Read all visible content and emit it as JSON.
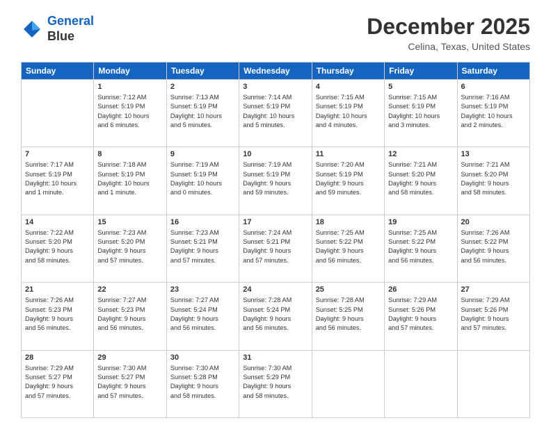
{
  "header": {
    "logo_line1": "General",
    "logo_line2": "Blue",
    "month": "December 2025",
    "location": "Celina, Texas, United States"
  },
  "days_of_week": [
    "Sunday",
    "Monday",
    "Tuesday",
    "Wednesday",
    "Thursday",
    "Friday",
    "Saturday"
  ],
  "weeks": [
    [
      {
        "day": "",
        "info": ""
      },
      {
        "day": "1",
        "info": "Sunrise: 7:12 AM\nSunset: 5:19 PM\nDaylight: 10 hours\nand 6 minutes."
      },
      {
        "day": "2",
        "info": "Sunrise: 7:13 AM\nSunset: 5:19 PM\nDaylight: 10 hours\nand 5 minutes."
      },
      {
        "day": "3",
        "info": "Sunrise: 7:14 AM\nSunset: 5:19 PM\nDaylight: 10 hours\nand 5 minutes."
      },
      {
        "day": "4",
        "info": "Sunrise: 7:15 AM\nSunset: 5:19 PM\nDaylight: 10 hours\nand 4 minutes."
      },
      {
        "day": "5",
        "info": "Sunrise: 7:15 AM\nSunset: 5:19 PM\nDaylight: 10 hours\nand 3 minutes."
      },
      {
        "day": "6",
        "info": "Sunrise: 7:16 AM\nSunset: 5:19 PM\nDaylight: 10 hours\nand 2 minutes."
      }
    ],
    [
      {
        "day": "7",
        "info": "Sunrise: 7:17 AM\nSunset: 5:19 PM\nDaylight: 10 hours\nand 1 minute."
      },
      {
        "day": "8",
        "info": "Sunrise: 7:18 AM\nSunset: 5:19 PM\nDaylight: 10 hours\nand 1 minute."
      },
      {
        "day": "9",
        "info": "Sunrise: 7:19 AM\nSunset: 5:19 PM\nDaylight: 10 hours\nand 0 minutes."
      },
      {
        "day": "10",
        "info": "Sunrise: 7:19 AM\nSunset: 5:19 PM\nDaylight: 9 hours\nand 59 minutes."
      },
      {
        "day": "11",
        "info": "Sunrise: 7:20 AM\nSunset: 5:19 PM\nDaylight: 9 hours\nand 59 minutes."
      },
      {
        "day": "12",
        "info": "Sunrise: 7:21 AM\nSunset: 5:20 PM\nDaylight: 9 hours\nand 58 minutes."
      },
      {
        "day": "13",
        "info": "Sunrise: 7:21 AM\nSunset: 5:20 PM\nDaylight: 9 hours\nand 58 minutes."
      }
    ],
    [
      {
        "day": "14",
        "info": "Sunrise: 7:22 AM\nSunset: 5:20 PM\nDaylight: 9 hours\nand 58 minutes."
      },
      {
        "day": "15",
        "info": "Sunrise: 7:23 AM\nSunset: 5:20 PM\nDaylight: 9 hours\nand 57 minutes."
      },
      {
        "day": "16",
        "info": "Sunrise: 7:23 AM\nSunset: 5:21 PM\nDaylight: 9 hours\nand 57 minutes."
      },
      {
        "day": "17",
        "info": "Sunrise: 7:24 AM\nSunset: 5:21 PM\nDaylight: 9 hours\nand 57 minutes."
      },
      {
        "day": "18",
        "info": "Sunrise: 7:25 AM\nSunset: 5:22 PM\nDaylight: 9 hours\nand 56 minutes."
      },
      {
        "day": "19",
        "info": "Sunrise: 7:25 AM\nSunset: 5:22 PM\nDaylight: 9 hours\nand 56 minutes."
      },
      {
        "day": "20",
        "info": "Sunrise: 7:26 AM\nSunset: 5:22 PM\nDaylight: 9 hours\nand 56 minutes."
      }
    ],
    [
      {
        "day": "21",
        "info": "Sunrise: 7:26 AM\nSunset: 5:23 PM\nDaylight: 9 hours\nand 56 minutes."
      },
      {
        "day": "22",
        "info": "Sunrise: 7:27 AM\nSunset: 5:23 PM\nDaylight: 9 hours\nand 56 minutes."
      },
      {
        "day": "23",
        "info": "Sunrise: 7:27 AM\nSunset: 5:24 PM\nDaylight: 9 hours\nand 56 minutes."
      },
      {
        "day": "24",
        "info": "Sunrise: 7:28 AM\nSunset: 5:24 PM\nDaylight: 9 hours\nand 56 minutes."
      },
      {
        "day": "25",
        "info": "Sunrise: 7:28 AM\nSunset: 5:25 PM\nDaylight: 9 hours\nand 56 minutes."
      },
      {
        "day": "26",
        "info": "Sunrise: 7:29 AM\nSunset: 5:26 PM\nDaylight: 9 hours\nand 57 minutes."
      },
      {
        "day": "27",
        "info": "Sunrise: 7:29 AM\nSunset: 5:26 PM\nDaylight: 9 hours\nand 57 minutes."
      }
    ],
    [
      {
        "day": "28",
        "info": "Sunrise: 7:29 AM\nSunset: 5:27 PM\nDaylight: 9 hours\nand 57 minutes."
      },
      {
        "day": "29",
        "info": "Sunrise: 7:30 AM\nSunset: 5:27 PM\nDaylight: 9 hours\nand 57 minutes."
      },
      {
        "day": "30",
        "info": "Sunrise: 7:30 AM\nSunset: 5:28 PM\nDaylight: 9 hours\nand 58 minutes."
      },
      {
        "day": "31",
        "info": "Sunrise: 7:30 AM\nSunset: 5:29 PM\nDaylight: 9 hours\nand 58 minutes."
      },
      {
        "day": "",
        "info": ""
      },
      {
        "day": "",
        "info": ""
      },
      {
        "day": "",
        "info": ""
      }
    ]
  ]
}
